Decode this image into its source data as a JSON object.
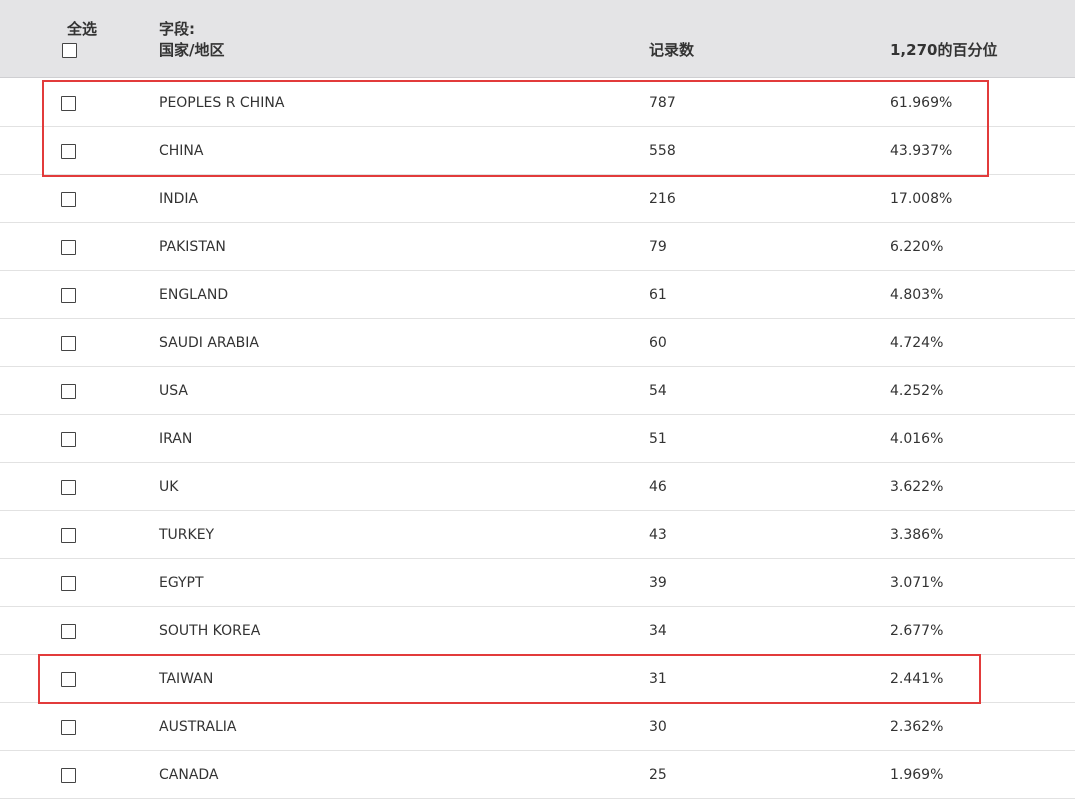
{
  "header": {
    "select_all_label": "全选",
    "field_label_line1": "字段:",
    "field_label_line2": "国家/地区",
    "count_label": "记录数",
    "percent_label": "1,270的百分位"
  },
  "rows": [
    {
      "name": "PEOPLES R CHINA",
      "count": "787",
      "percent": "61.969%"
    },
    {
      "name": "CHINA",
      "count": "558",
      "percent": "43.937%"
    },
    {
      "name": "INDIA",
      "count": "216",
      "percent": "17.008%"
    },
    {
      "name": "PAKISTAN",
      "count": "79",
      "percent": "6.220%"
    },
    {
      "name": "ENGLAND",
      "count": "61",
      "percent": "4.803%"
    },
    {
      "name": "SAUDI ARABIA",
      "count": "60",
      "percent": "4.724%"
    },
    {
      "name": "USA",
      "count": "54",
      "percent": "4.252%"
    },
    {
      "name": "IRAN",
      "count": "51",
      "percent": "4.016%"
    },
    {
      "name": "UK",
      "count": "46",
      "percent": "3.622%"
    },
    {
      "name": "TURKEY",
      "count": "43",
      "percent": "3.386%"
    },
    {
      "name": "EGYPT",
      "count": "39",
      "percent": "3.071%"
    },
    {
      "name": "SOUTH KOREA",
      "count": "34",
      "percent": "2.677%"
    },
    {
      "name": "TAIWAN",
      "count": "31",
      "percent": "2.441%"
    },
    {
      "name": "AUSTRALIA",
      "count": "30",
      "percent": "2.362%"
    },
    {
      "name": "CANADA",
      "count": "25",
      "percent": "1.969%"
    }
  ],
  "colors": {
    "header_bg": "#e4e4e6",
    "highlight": "#e23b3b",
    "text": "#333333"
  }
}
